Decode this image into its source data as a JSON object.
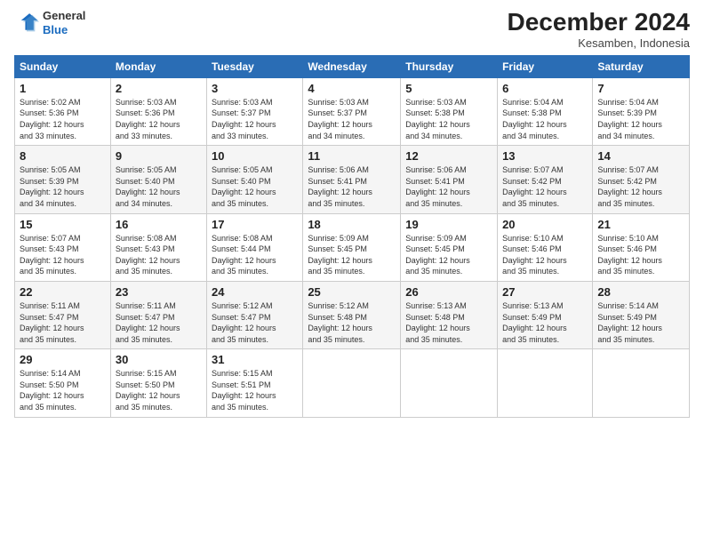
{
  "header": {
    "logo_line1": "General",
    "logo_line2": "Blue",
    "month_title": "December 2024",
    "location": "Kesamben, Indonesia"
  },
  "weekdays": [
    "Sunday",
    "Monday",
    "Tuesday",
    "Wednesday",
    "Thursday",
    "Friday",
    "Saturday"
  ],
  "weeks": [
    [
      {
        "day": "1",
        "sunrise": "5:02 AM",
        "sunset": "5:36 PM",
        "daylight": "12 hours and 33 minutes."
      },
      {
        "day": "2",
        "sunrise": "5:03 AM",
        "sunset": "5:36 PM",
        "daylight": "12 hours and 33 minutes."
      },
      {
        "day": "3",
        "sunrise": "5:03 AM",
        "sunset": "5:37 PM",
        "daylight": "12 hours and 33 minutes."
      },
      {
        "day": "4",
        "sunrise": "5:03 AM",
        "sunset": "5:37 PM",
        "daylight": "12 hours and 34 minutes."
      },
      {
        "day": "5",
        "sunrise": "5:03 AM",
        "sunset": "5:38 PM",
        "daylight": "12 hours and 34 minutes."
      },
      {
        "day": "6",
        "sunrise": "5:04 AM",
        "sunset": "5:38 PM",
        "daylight": "12 hours and 34 minutes."
      },
      {
        "day": "7",
        "sunrise": "5:04 AM",
        "sunset": "5:39 PM",
        "daylight": "12 hours and 34 minutes."
      }
    ],
    [
      {
        "day": "8",
        "sunrise": "5:05 AM",
        "sunset": "5:39 PM",
        "daylight": "12 hours and 34 minutes."
      },
      {
        "day": "9",
        "sunrise": "5:05 AM",
        "sunset": "5:40 PM",
        "daylight": "12 hours and 34 minutes."
      },
      {
        "day": "10",
        "sunrise": "5:05 AM",
        "sunset": "5:40 PM",
        "daylight": "12 hours and 35 minutes."
      },
      {
        "day": "11",
        "sunrise": "5:06 AM",
        "sunset": "5:41 PM",
        "daylight": "12 hours and 35 minutes."
      },
      {
        "day": "12",
        "sunrise": "5:06 AM",
        "sunset": "5:41 PM",
        "daylight": "12 hours and 35 minutes."
      },
      {
        "day": "13",
        "sunrise": "5:07 AM",
        "sunset": "5:42 PM",
        "daylight": "12 hours and 35 minutes."
      },
      {
        "day": "14",
        "sunrise": "5:07 AM",
        "sunset": "5:42 PM",
        "daylight": "12 hours and 35 minutes."
      }
    ],
    [
      {
        "day": "15",
        "sunrise": "5:07 AM",
        "sunset": "5:43 PM",
        "daylight": "12 hours and 35 minutes."
      },
      {
        "day": "16",
        "sunrise": "5:08 AM",
        "sunset": "5:43 PM",
        "daylight": "12 hours and 35 minutes."
      },
      {
        "day": "17",
        "sunrise": "5:08 AM",
        "sunset": "5:44 PM",
        "daylight": "12 hours and 35 minutes."
      },
      {
        "day": "18",
        "sunrise": "5:09 AM",
        "sunset": "5:45 PM",
        "daylight": "12 hours and 35 minutes."
      },
      {
        "day": "19",
        "sunrise": "5:09 AM",
        "sunset": "5:45 PM",
        "daylight": "12 hours and 35 minutes."
      },
      {
        "day": "20",
        "sunrise": "5:10 AM",
        "sunset": "5:46 PM",
        "daylight": "12 hours and 35 minutes."
      },
      {
        "day": "21",
        "sunrise": "5:10 AM",
        "sunset": "5:46 PM",
        "daylight": "12 hours and 35 minutes."
      }
    ],
    [
      {
        "day": "22",
        "sunrise": "5:11 AM",
        "sunset": "5:47 PM",
        "daylight": "12 hours and 35 minutes."
      },
      {
        "day": "23",
        "sunrise": "5:11 AM",
        "sunset": "5:47 PM",
        "daylight": "12 hours and 35 minutes."
      },
      {
        "day": "24",
        "sunrise": "5:12 AM",
        "sunset": "5:47 PM",
        "daylight": "12 hours and 35 minutes."
      },
      {
        "day": "25",
        "sunrise": "5:12 AM",
        "sunset": "5:48 PM",
        "daylight": "12 hours and 35 minutes."
      },
      {
        "day": "26",
        "sunrise": "5:13 AM",
        "sunset": "5:48 PM",
        "daylight": "12 hours and 35 minutes."
      },
      {
        "day": "27",
        "sunrise": "5:13 AM",
        "sunset": "5:49 PM",
        "daylight": "12 hours and 35 minutes."
      },
      {
        "day": "28",
        "sunrise": "5:14 AM",
        "sunset": "5:49 PM",
        "daylight": "12 hours and 35 minutes."
      }
    ],
    [
      {
        "day": "29",
        "sunrise": "5:14 AM",
        "sunset": "5:50 PM",
        "daylight": "12 hours and 35 minutes."
      },
      {
        "day": "30",
        "sunrise": "5:15 AM",
        "sunset": "5:50 PM",
        "daylight": "12 hours and 35 minutes."
      },
      {
        "day": "31",
        "sunrise": "5:15 AM",
        "sunset": "5:51 PM",
        "daylight": "12 hours and 35 minutes."
      },
      null,
      null,
      null,
      null
    ]
  ],
  "labels": {
    "sunrise": "Sunrise:",
    "sunset": "Sunset:",
    "daylight": "Daylight:"
  }
}
